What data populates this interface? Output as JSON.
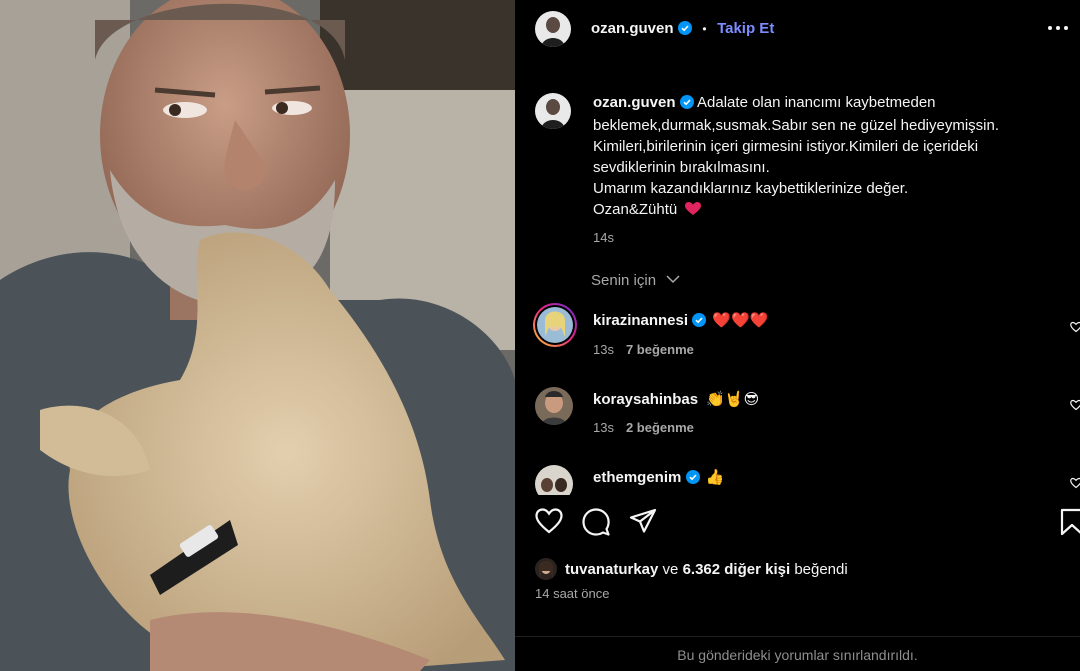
{
  "post": {
    "image_description_icon": "photo",
    "author": "ozan.guven",
    "follow_label": "Takip Et",
    "dot": "•"
  },
  "caption": {
    "username": "ozan.guven",
    "lines": [
      "Adalate olan inancımı kaybetmeden",
      "beklemek,durmak,susmak.Sabır sen ne güzel hediyeymişsin.",
      "Kimileri,birilerinin içeri girmesini istiyor.Kimileri de içerideki",
      "sevdiklerinin bırakılmasını.",
      "Umarım kazandıklarınız kaybettiklerinize değer.",
      "Ozan&Zühtü"
    ],
    "time": "14s"
  },
  "filter": {
    "label": "Senin için"
  },
  "comments": [
    {
      "username": "kirazinannesi",
      "verified": true,
      "text": "❤️❤️❤️",
      "time": "13s",
      "likes": "7 beğenme"
    },
    {
      "username": "koraysahinbas",
      "verified": false,
      "text": "👏🤘😎",
      "time": "13s",
      "likes": "2 beğenme"
    },
    {
      "username": "ethemgenim",
      "verified": true,
      "text": "👍",
      "time": "",
      "likes": ""
    }
  ],
  "likes": {
    "user": "tuvanaturkay",
    "connector": "ve",
    "others": "6.362 diğer kişi",
    "suffix": "beğendi"
  },
  "time_ago": "14 saat önce",
  "restricted_note": "Bu gönderideki yorumlar sınırlandırıldı.",
  "colors": {
    "accent": "#7d8cff",
    "verified": "#0095f6",
    "heart": "#ff3040",
    "muted": "#a8a8a8"
  }
}
